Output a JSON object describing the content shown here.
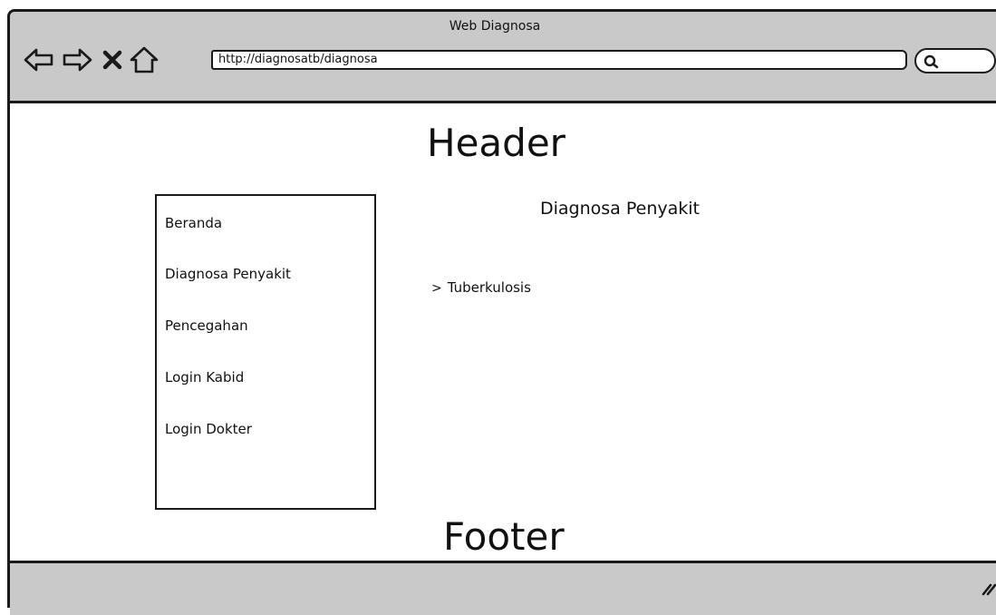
{
  "window": {
    "title": "Web Diagnosa"
  },
  "toolbar": {
    "url": "http://diagnosatb/diagnosa",
    "icons": [
      "back-arrow-icon",
      "forward-arrow-icon",
      "close-x-icon",
      "home-icon",
      "search-icon"
    ]
  },
  "page": {
    "header": "Header",
    "footer": "Footer"
  },
  "sidebar": {
    "items": [
      {
        "label": "Beranda"
      },
      {
        "label": "Diagnosa Penyakit"
      },
      {
        "label": "Pencegahan"
      },
      {
        "label": "Login Kabid"
      },
      {
        "label": "Login Dokter"
      }
    ]
  },
  "content": {
    "title": "Diagnosa Penyakit",
    "tree": [
      {
        "label": "Tuberkulosis",
        "icon": "chevron-right-icon"
      }
    ]
  },
  "colors": {
    "chrome": "#c9c9c9",
    "stroke": "#1a1a1a",
    "page": "#ffffff"
  }
}
